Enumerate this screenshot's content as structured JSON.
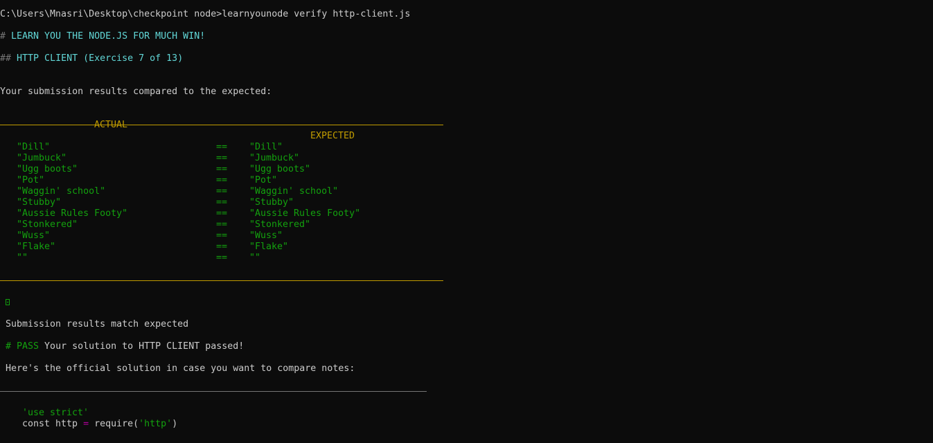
{
  "prompt": {
    "text": "C:\\Users\\Mnasri\\Desktop\\checkpoint node>learnyounode verify http-client.js"
  },
  "banner": {
    "hash": "# ",
    "title": "LEARN YOU THE NODE.JS FOR MUCH WIN!"
  },
  "exercise": {
    "hash": "## ",
    "title": "HTTP CLIENT (Exercise 7 of 13)"
  },
  "comparison": {
    "intro": "Your submission results compared to the expected:",
    "actual_header": "ACTUAL",
    "expected_header": "EXPECTED",
    "rows": [
      {
        "actual": "\"Dill\"",
        "op": "==",
        "expected": "\"Dill\""
      },
      {
        "actual": "\"Jumbuck\"",
        "op": "==",
        "expected": "\"Jumbuck\""
      },
      {
        "actual": "\"Ugg boots\"",
        "op": "==",
        "expected": "\"Ugg boots\""
      },
      {
        "actual": "\"Pot\"",
        "op": "==",
        "expected": "\"Pot\""
      },
      {
        "actual": "\"Waggin' school\"",
        "op": "==",
        "expected": "\"Waggin' school\""
      },
      {
        "actual": "\"Stubby\"",
        "op": "==",
        "expected": "\"Stubby\""
      },
      {
        "actual": "\"Aussie Rules Footy\"",
        "op": "==",
        "expected": "\"Aussie Rules Footy\""
      },
      {
        "actual": "\"Stonkered\"",
        "op": "==",
        "expected": "\"Stonkered\""
      },
      {
        "actual": "\"Wuss\"",
        "op": "==",
        "expected": "\"Wuss\""
      },
      {
        "actual": "\"Flake\"",
        "op": "==",
        "expected": "\"Flake\""
      },
      {
        "actual": "\"\"",
        "op": "==",
        "expected": "\"\""
      }
    ]
  },
  "result": {
    "match_text": "Submission results match expected",
    "pass_hash": "# ",
    "pass_label": "PASS",
    "pass_message": " Your solution to HTTP CLIENT passed!",
    "official_intro": "Here's the official solution in case you want to compare notes:"
  },
  "solution_code": {
    "line1": "'use strict'",
    "line2_decl": "const http ",
    "line2_op": "=",
    "line2_call": " require(",
    "line2_arg": "'http'",
    "line2_close": ")"
  },
  "colors": {
    "background": "#0c0c0c",
    "text": "#cccccc",
    "cyan": "#61d6d6",
    "gold": "#c19c00",
    "green": "#13a10e",
    "muted": "#767676",
    "operator": "#b4009e"
  }
}
